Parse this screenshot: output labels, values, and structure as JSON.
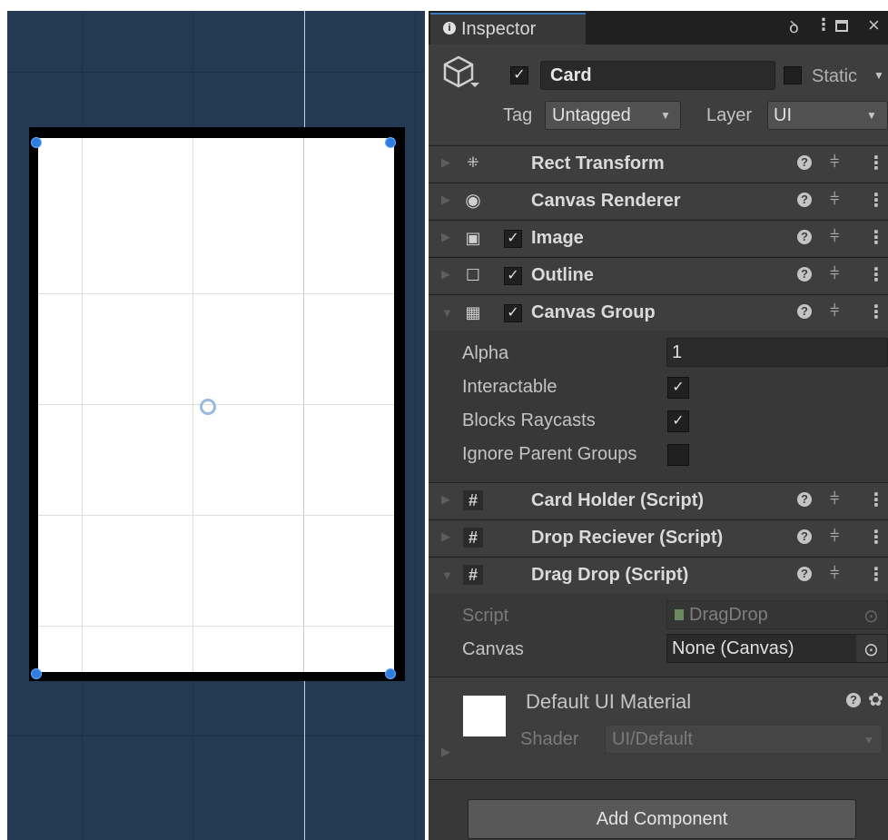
{
  "inspector": {
    "tab_label": "Inspector",
    "object": {
      "active_checked": "✓",
      "name": "Card",
      "static_label": "Static",
      "tag_label": "Tag",
      "tag_value": "Untagged",
      "layer_label": "Layer",
      "layer_value": "UI"
    },
    "components": [
      {
        "name": "Rect Transform",
        "icon": "rect-transform-icon",
        "expanded": false
      },
      {
        "name": "Canvas Renderer",
        "icon": "eye-icon",
        "expanded": false
      },
      {
        "name": "Image",
        "icon": "image-icon",
        "expanded": false,
        "enabled": true
      },
      {
        "name": "Outline",
        "icon": "outline-icon",
        "expanded": false,
        "enabled": true
      },
      {
        "name": "Canvas Group",
        "icon": "canvas-group-icon",
        "expanded": true,
        "enabled": true
      },
      {
        "name": "Card Holder (Script)",
        "icon": "script-icon",
        "expanded": false
      },
      {
        "name": "Drop Reciever (Script)",
        "icon": "script-icon",
        "expanded": false
      },
      {
        "name": "Drag Drop (Script)",
        "icon": "script-icon",
        "expanded": true
      }
    ],
    "canvas_group": {
      "alpha_label": "Alpha",
      "alpha_value": "1",
      "interactable_label": "Interactable",
      "interactable_checked": "✓",
      "blocks_raycasts_label": "Blocks Raycasts",
      "blocks_raycasts_checked": "✓",
      "ignore_parent_label": "Ignore Parent Groups"
    },
    "drag_drop": {
      "script_label": "Script",
      "script_value": "DragDrop",
      "canvas_label": "Canvas",
      "canvas_value": "None (Canvas)"
    },
    "material": {
      "name": "Default UI Material",
      "shader_label": "Shader",
      "shader_value": "UI/Default"
    },
    "add_component_label": "Add Component"
  },
  "colors": {
    "scene_bg": "#243a52",
    "inspector_bg": "#383838",
    "accent": "#3a79bb",
    "handle": "#2f7de1"
  }
}
